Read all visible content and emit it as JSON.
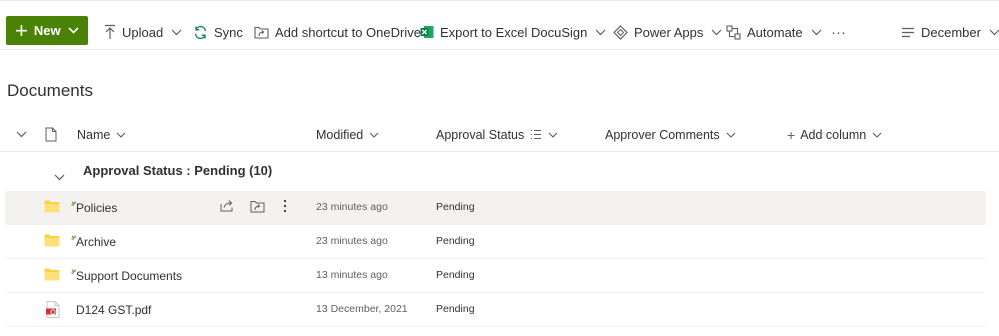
{
  "toolbar": {
    "new_label": "New",
    "upload_label": "Upload",
    "sync_label": "Sync",
    "shortcut_label": "Add shortcut to OneDrive",
    "export_label": "Export to Excel",
    "docusign_label": "DocuSign",
    "powerapps_label": "Power Apps",
    "automate_label": "Automate",
    "more_label": "···",
    "view_label": "December"
  },
  "page_title": "Documents",
  "columns": {
    "name": "Name",
    "modified": "Modified",
    "approval_status": "Approval Status",
    "approver_comments": "Approver Comments",
    "add_column": "Add column"
  },
  "group": {
    "label": "Approval Status : Pending (10)"
  },
  "rows": [
    {
      "name": "Policies",
      "modified": "23 minutes ago",
      "status": "Pending",
      "type": "folder"
    },
    {
      "name": "Archive",
      "modified": "23 minutes ago",
      "status": "Pending",
      "type": "folder"
    },
    {
      "name": "Support Documents",
      "modified": "13 minutes ago",
      "status": "Pending",
      "type": "folder"
    },
    {
      "name": "D124 GST.pdf",
      "modified": "13 December, 2021",
      "status": "Pending",
      "type": "pdf"
    }
  ],
  "colors": {
    "brand_green": "#498205",
    "excel_green": "#107c41",
    "folder_yellow": "#f8d347",
    "pdf_red": "#d13438"
  }
}
